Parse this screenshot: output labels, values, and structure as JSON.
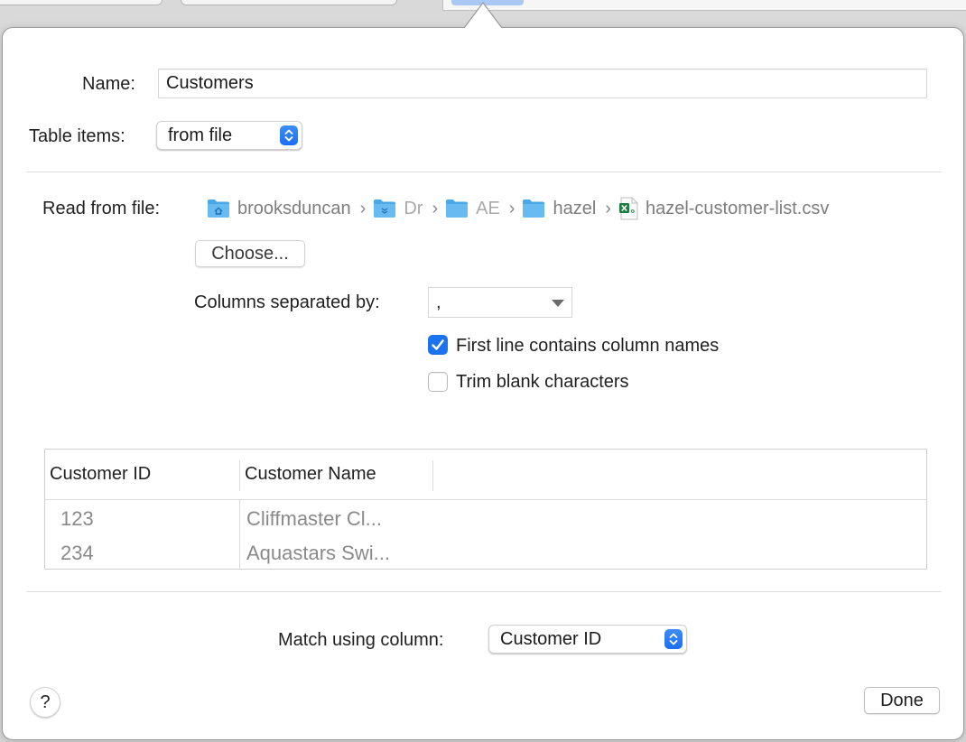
{
  "form": {
    "name_label": "Name:",
    "name_value": "Customers",
    "table_items_label": "Table items:",
    "table_items_value": "from file",
    "read_from_file_label": "Read from file:",
    "path": [
      {
        "label": "brooksduncan",
        "icon": "home-folder-icon"
      },
      {
        "label": "Dr",
        "icon": "dropbox-folder-icon"
      },
      {
        "label": "AE",
        "icon": "folder-icon"
      },
      {
        "label": "hazel",
        "icon": "folder-icon"
      },
      {
        "label": "hazel-customer-list.csv",
        "icon": "excel-file-icon"
      }
    ],
    "choose_label": "Choose...",
    "columns_separated_label": "Columns separated by:",
    "separator_value": ",",
    "first_line_label": "First line contains column names",
    "first_line_checked": true,
    "trim_blank_label": "Trim blank characters",
    "trim_blank_checked": false
  },
  "preview_table": {
    "columns": [
      "Customer ID",
      "Customer Name"
    ],
    "rows": [
      [
        "123",
        "Cliffmaster Cl..."
      ],
      [
        "234",
        "Aquastars Swi..."
      ]
    ]
  },
  "match": {
    "label": "Match using column:",
    "value": "Customer ID"
  },
  "footer": {
    "help_label": "?",
    "done_label": "Done"
  },
  "colors": {
    "accent": "#1b73f0",
    "folder": "#5fb7ee",
    "muted_text": "#8a8a8a"
  }
}
